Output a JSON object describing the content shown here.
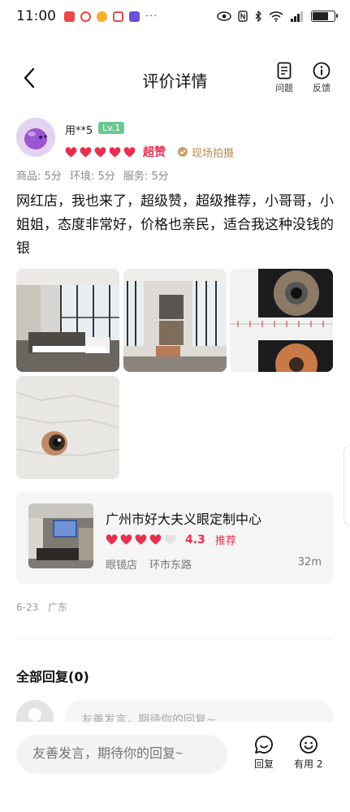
{
  "status_bar": {
    "time": "11:00",
    "notif_more": "···"
  },
  "header": {
    "title": "评价详情",
    "issue_label": "问题",
    "feedback_label": "反馈"
  },
  "review": {
    "user_name": "用**5",
    "level": "Lv.1",
    "hearts_filled": 5,
    "rating_text": "超赞",
    "live_badge": "现场拍摄",
    "scores": {
      "product": "商品: 5分",
      "environment": "环境: 5分",
      "service": "服务: 5分"
    },
    "text": "网红店，我也来了，超级赞，超级推荐，小哥哥，小姐姐，态度非常好，价格也亲民，适合我这种没钱的银",
    "photo_count": 4
  },
  "shop": {
    "name": "广州市好大夫义眼定制中心",
    "hearts_filled": 4,
    "score": "4.3",
    "recommend": "推荐",
    "category": "眼镜店",
    "area": "环市东路",
    "distance": "32m"
  },
  "meta": {
    "date": "6-23",
    "location": "广东"
  },
  "replies": {
    "title": "全部回复(0)",
    "placeholder": "友善发言，期待你的回复~"
  },
  "bottom_bar": {
    "input_placeholder": "友善发言，期待你的回复~",
    "reply_label": "回复",
    "useful_label": "有用 2"
  },
  "colors": {
    "accent": "#e6304e",
    "level_badge": "#6cc790",
    "live_badge": "#b88a4e"
  }
}
